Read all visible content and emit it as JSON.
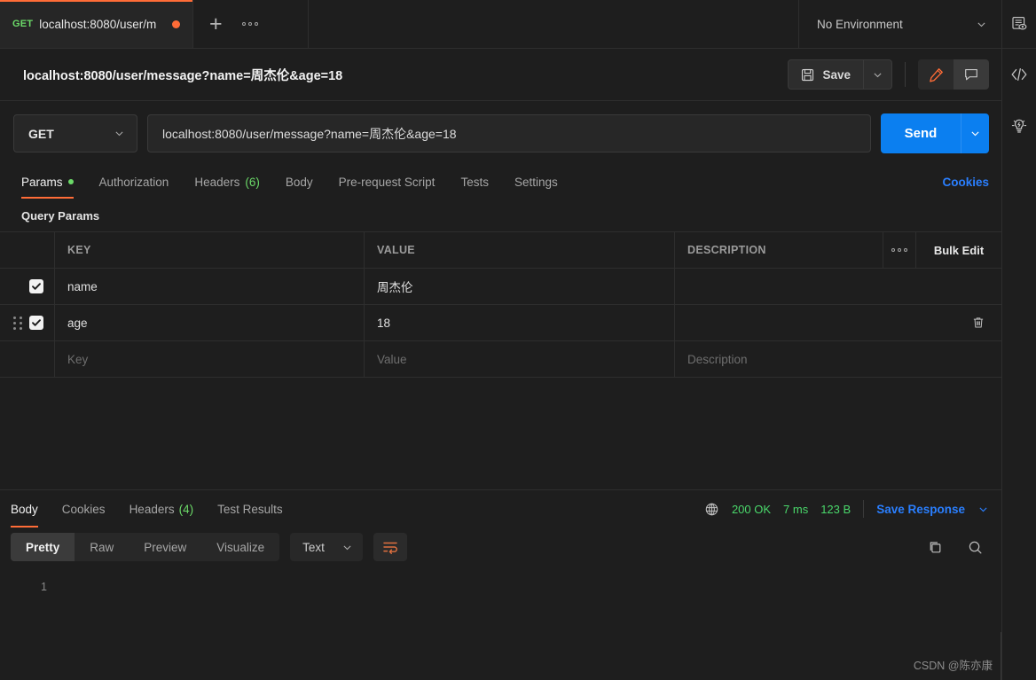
{
  "tabbar": {
    "tab": {
      "method": "GET",
      "name": "localhost:8080/user/m",
      "unsaved_dot": "●"
    },
    "new_tab_label": "+",
    "more_label": "•••",
    "environment": {
      "selected": "No Environment"
    }
  },
  "request_header": {
    "title": "localhost:8080/user/message?name=周杰伦&age=18",
    "save_label": "Save"
  },
  "url_row": {
    "method": "GET",
    "url": "localhost:8080/user/message?name=周杰伦&age=18",
    "send_label": "Send"
  },
  "request_tabs": {
    "items": [
      {
        "label": "Params",
        "count": "",
        "dot": true,
        "active": true
      },
      {
        "label": "Authorization",
        "count": "",
        "dot": false,
        "active": false
      },
      {
        "label": "Headers",
        "count": "(6)",
        "dot": false,
        "active": false
      },
      {
        "label": "Body",
        "count": "",
        "dot": false,
        "active": false
      },
      {
        "label": "Pre-request Script",
        "count": "",
        "dot": false,
        "active": false
      },
      {
        "label": "Tests",
        "count": "",
        "dot": false,
        "active": false
      },
      {
        "label": "Settings",
        "count": "",
        "dot": false,
        "active": false
      }
    ],
    "cookies_label": "Cookies"
  },
  "params": {
    "section_title": "Query Params",
    "columns": {
      "key": "KEY",
      "value": "VALUE",
      "description": "DESCRIPTION"
    },
    "bulk_edit_label": "Bulk Edit",
    "more_label": "•••",
    "rows": [
      {
        "checked": true,
        "key": "name",
        "value": "周杰伦",
        "description": "",
        "has_grip": false,
        "has_trash": false
      },
      {
        "checked": true,
        "key": "age",
        "value": "18",
        "description": "",
        "has_grip": true,
        "has_trash": true
      }
    ],
    "placeholder_row": {
      "key": "Key",
      "value": "Value",
      "description": "Description"
    }
  },
  "response": {
    "tabs": [
      {
        "label": "Body",
        "count": "",
        "active": true
      },
      {
        "label": "Cookies",
        "count": "",
        "active": false
      },
      {
        "label": "Headers",
        "count": "(4)",
        "active": false
      },
      {
        "label": "Test Results",
        "count": "",
        "active": false
      }
    ],
    "status": "200 OK",
    "time": "7 ms",
    "size": "123 B",
    "save_response_label": "Save Response",
    "view_modes": [
      {
        "label": "Pretty",
        "active": true
      },
      {
        "label": "Raw",
        "active": false
      },
      {
        "label": "Preview",
        "active": false
      },
      {
        "label": "Visualize",
        "active": false
      }
    ],
    "format": "Text",
    "line_number": "1",
    "body_text": ""
  },
  "watermark": "CSDN @陈亦康",
  "colors": {
    "accent_orange": "#ff6c37",
    "send_blue": "#0b7ff0",
    "link_blue": "#2a7fff",
    "status_green": "#4ad86b",
    "method_green": "#6bd968",
    "background": "#1e1e1e",
    "panel": "#262626"
  }
}
